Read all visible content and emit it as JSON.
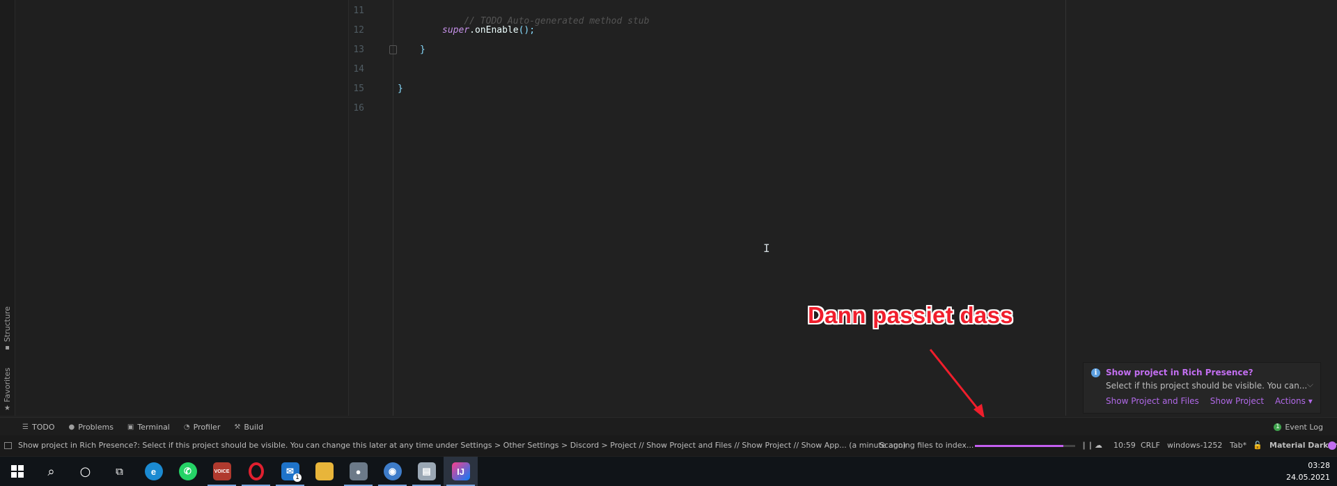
{
  "side_tabs": {
    "structure": "Structure",
    "favorites": "Favorites"
  },
  "gutter": {
    "line_numbers": [
      "11",
      "12",
      "13",
      "14",
      "15",
      "16"
    ]
  },
  "code": {
    "line11_comment": "// TODO Auto-generated method stub",
    "line12_kw": "super",
    "line12_call": ".onEnable",
    "line12_punc": "();",
    "line13_brace": "}",
    "line15_brace": "}"
  },
  "annotation": {
    "text": "Dann passiet dass",
    "color": "#f01e2c"
  },
  "notification": {
    "title": "Show project in Rich Presence?",
    "body": "Select if this project should be visible. You can...",
    "actions": [
      "Show Project and Files",
      "Show Project",
      "Actions ▾"
    ]
  },
  "toolwindows": [
    {
      "label": "TODO",
      "icon": "list-icon"
    },
    {
      "label": "Problems",
      "icon": "warning-icon"
    },
    {
      "label": "Terminal",
      "icon": "terminal-icon"
    },
    {
      "label": "Profiler",
      "icon": "profiler-icon"
    },
    {
      "label": "Build",
      "icon": "hammer-icon"
    }
  ],
  "event_log": {
    "label": "Event Log",
    "count": "1"
  },
  "status": {
    "message": "Show project in Rich Presence?: Select if this project should be visible. You can change this later at any time under Settings > Other Settings > Discord > Project // Show Project and Files // Show Project // Show App... (a minute ago)",
    "scanning": "Scanning files to index...",
    "progress_percent": 88,
    "position": "10:59",
    "line_sep": "CRLF",
    "encoding": "windows-1252",
    "indent": "Tab*",
    "theme": "Material Darker"
  },
  "taskbar": {
    "apps": [
      "start",
      "search",
      "cortana",
      "task-view",
      "edge",
      "whatsapp",
      "voicemeeter",
      "opera",
      "mail",
      "file-explorer",
      "screen-recorder",
      "app-circle",
      "app-photo",
      "intellij"
    ],
    "mail_badge": "1",
    "voicemeeter_label": "VOICE",
    "time": "03:28",
    "date": "24.05.2021"
  }
}
